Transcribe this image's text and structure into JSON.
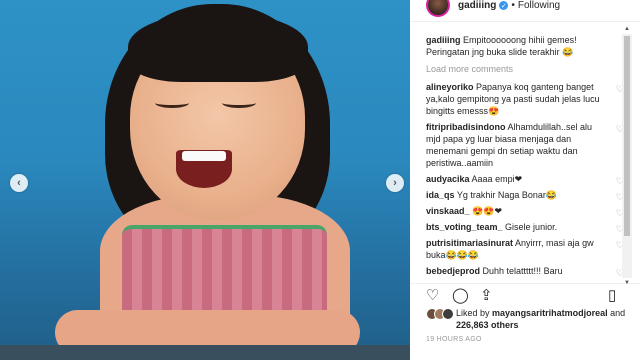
{
  "post": {
    "username": "gadiiing",
    "follow_status": "Following",
    "separator": "•"
  },
  "photo_nav": {
    "prev": "‹",
    "next": "›"
  },
  "caption": {
    "user": "gadiiing",
    "text": "Empitoooooong hihii gemes! Peringatan jng buka slide terakhir 😂"
  },
  "load_more": "Load more comments",
  "comments": [
    {
      "user": "alineyoriko",
      "text": "Papanya koq ganteng banget ya,kalo gempitong ya pasti sudah jelas lucu bingitts emesss😍"
    },
    {
      "user": "fitripribadisindono",
      "text": "Alhamdulillah..sel alu mjd papa yg luar biasa menjaga dan menemani gempi dn setiap waktu dan peristiwa..aamiin"
    },
    {
      "user": "audyacika",
      "text": "Aaaa empi❤"
    },
    {
      "user": "ida_qs",
      "text": "Yg trakhir Naga Bonar😂"
    },
    {
      "user": "vinskaad_",
      "text": "😍😍❤"
    },
    {
      "user": "bts_voting_team_",
      "text": "Gisele junior."
    },
    {
      "user": "putrisitimariasinurat",
      "text": "Anyirrr, masi aja gw buka😂😂😂"
    },
    {
      "user": "bebedjeprod",
      "text": "Duhh telattttt!!! Baru"
    }
  ],
  "icons": {
    "comment_heart": "♡",
    "like": "♡",
    "comment": "◯",
    "share": "⇪",
    "save": "▯",
    "verified": "✓"
  },
  "likes": {
    "prefix": "Liked by",
    "user": "mayangsaritrihatmodjoreal",
    "middle": "and",
    "count": "226,863 others"
  },
  "timestamp": "19 HOURS AGO"
}
